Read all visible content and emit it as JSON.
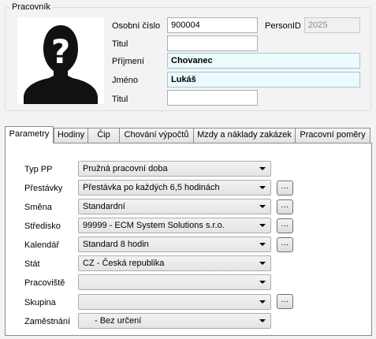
{
  "employee_group": {
    "legend": "Pracovník",
    "personal_number_label": "Osobní číslo",
    "personal_number_value": "900004",
    "person_id_label": "PersonID",
    "person_id_value": "2025",
    "title_before_label": "Titul",
    "title_before_value": "",
    "surname_label": "Příjmení",
    "surname_value": "Chovanec",
    "first_name_label": "Jméno",
    "first_name_value": "Lukáš",
    "title_after_label": "Titul",
    "title_after_value": "",
    "photo_icon": "unknown-person-silhouette-icon"
  },
  "tabs": [
    {
      "label": "Parametry",
      "active": true
    },
    {
      "label": "Hodiny"
    },
    {
      "label": "Čip"
    },
    {
      "label": "Chování výpočtů"
    },
    {
      "label": "Mzdy a náklady zakázek"
    },
    {
      "label": "Pracovní poměry"
    }
  ],
  "parameters": [
    {
      "label": "Typ PP",
      "value": "Pružná pracovní doba",
      "has_browse": false
    },
    {
      "label": "Přestávky",
      "value": "Přestávka po každých 6,5 hodinách",
      "has_browse": true
    },
    {
      "label": "Směna",
      "value": "Standardní",
      "has_browse": true
    },
    {
      "label": "Středisko",
      "value": "99999 - ECM System Solutions s.r.o.",
      "has_browse": true
    },
    {
      "label": "Kalendář",
      "value": "Standard 8 hodin",
      "has_browse": true
    },
    {
      "label": "Stát",
      "value": "CZ - Česká republika",
      "has_browse": false
    },
    {
      "label": "Pracoviště",
      "value": "",
      "has_browse": false
    },
    {
      "label": "Skupina",
      "value": "",
      "has_browse": true
    },
    {
      "label": "Zaměstnání",
      "value": "- Bez určení",
      "has_browse": false
    }
  ],
  "browse_button_label": "...",
  "colors": {
    "name_field_bg": "#ebfafd",
    "panel_bg": "#ffffff",
    "window_bg": "#f3f3f3"
  }
}
